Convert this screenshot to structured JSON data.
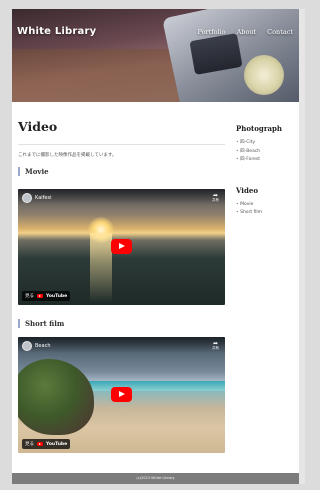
{
  "site": {
    "title": "White Library",
    "nav": [
      "Portfolio",
      "About",
      "Contact"
    ]
  },
  "main": {
    "page_title": "Video",
    "intro": "これまでに撮影した映像作品を掲載しています。",
    "sections": [
      {
        "heading": "Movie",
        "video": {
          "title": "Kaifesi",
          "share_label": "共有",
          "watch_label": "見る",
          "youtube_label": "YouTube"
        }
      },
      {
        "heading": "Short film",
        "video": {
          "title": "Beach",
          "share_label": "共有",
          "watch_label": "見る",
          "youtube_label": "YouTube"
        }
      }
    ]
  },
  "sidebar": {
    "groups": [
      {
        "heading": "Photograph",
        "items": [
          "四-City",
          "四-Beach",
          "四-Forest"
        ]
      },
      {
        "heading": "Video",
        "items": [
          "Movie",
          "Short film"
        ]
      }
    ]
  },
  "footer": {
    "copyright": "(c)2023 White Library"
  },
  "colors": {
    "page_bg": "#dcdcdc",
    "footer_bg": "#7c7c7c",
    "play_button": "#ff0000",
    "section_accent": "#9aa9c7"
  },
  "icons": [
    "avatar-icon",
    "share-icon",
    "play-icon",
    "youtube-logo-icon"
  ]
}
